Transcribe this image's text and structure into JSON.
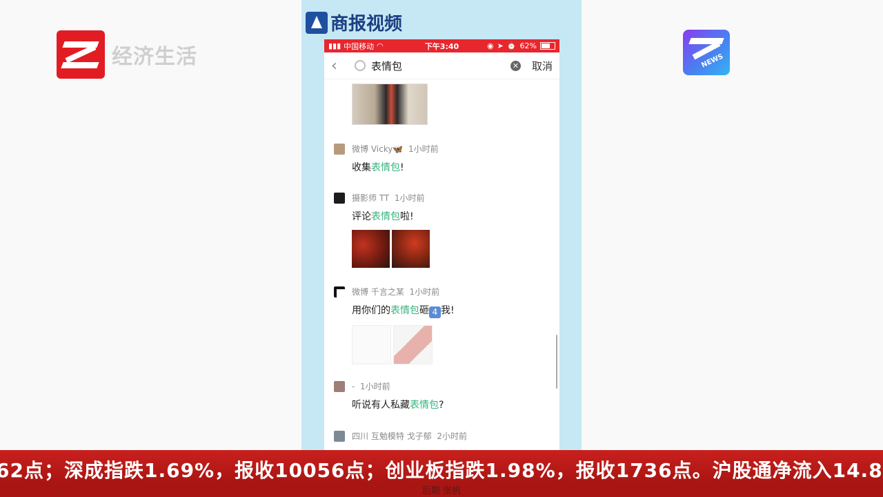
{
  "channel": {
    "name": "经济生活"
  },
  "news_logo": {
    "tag": "NEWS"
  },
  "brand": {
    "name": "商报视频"
  },
  "status_bar": {
    "carrier": "中国移动",
    "time": "下午3:40",
    "battery": "62%"
  },
  "search": {
    "query": "表情包",
    "cancel_label": "取消"
  },
  "feed": {
    "posts": [
      {
        "source": "微博",
        "user": "Vicky🦋",
        "time": "1小时前",
        "pre": "收集",
        "kw": "表情包",
        "post": "!"
      },
      {
        "source": "",
        "user": "摄影师 TT",
        "time": "1小时前",
        "pre": "评论",
        "kw": "表情包",
        "post": "啦!"
      },
      {
        "source": "微博",
        "user": "千言之某",
        "time": "1小时前",
        "pre": "用你们的",
        "kw": "表情包",
        "mid": "砸",
        "badge": "4",
        "post": "我!"
      },
      {
        "source": "",
        "user": "-",
        "time": "1小时前",
        "pre": "听说有人私藏",
        "kw": "表情包",
        "post": "?"
      },
      {
        "source": "四川",
        "user": "互勉模特 戈子郁",
        "time": "2小时前"
      }
    ]
  },
  "ticker": {
    "text": "62点；深成指跌1.69%，报收10056点；创业板指跌1.98%，报收1736点。沪股通净流入14.8"
  },
  "credit": {
    "text": "后期 张帆"
  }
}
